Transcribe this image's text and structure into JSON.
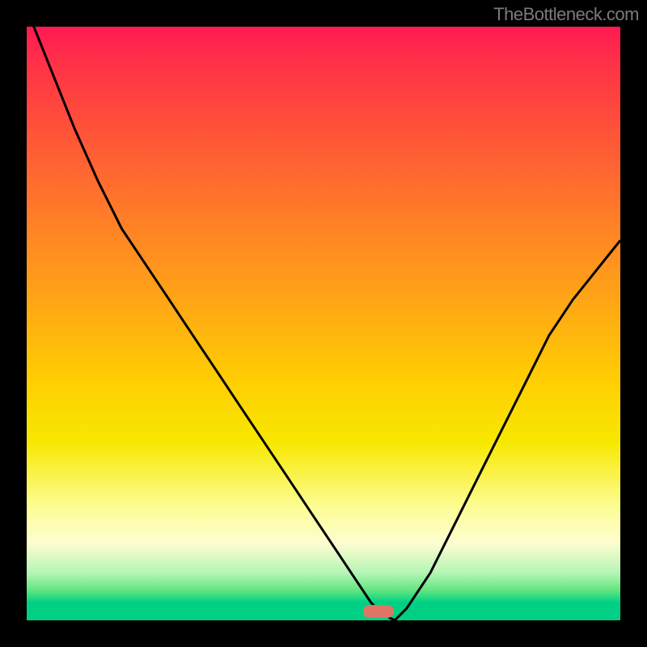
{
  "watermark": "TheBottleneck.com",
  "chart_data": {
    "type": "line",
    "title": "",
    "xlabel": "",
    "ylabel": "",
    "xlim": [
      0,
      100
    ],
    "ylim": [
      0,
      100
    ],
    "x": [
      0,
      4,
      8,
      12,
      16,
      20,
      24,
      28,
      32,
      36,
      40,
      44,
      48,
      52,
      56,
      58,
      60,
      62,
      64,
      68,
      72,
      76,
      80,
      84,
      88,
      92,
      96,
      100
    ],
    "values": [
      103,
      93,
      83,
      74,
      66,
      60,
      54,
      48,
      42,
      36,
      30,
      24,
      18,
      12,
      6,
      3,
      1,
      0,
      2,
      8,
      16,
      24,
      32,
      40,
      48,
      54,
      59,
      64
    ],
    "marker_x": 60,
    "gradient_stops": [
      {
        "pos": 0,
        "color": "#ff1a52"
      },
      {
        "pos": 100,
        "color": "#00d084"
      }
    ]
  }
}
